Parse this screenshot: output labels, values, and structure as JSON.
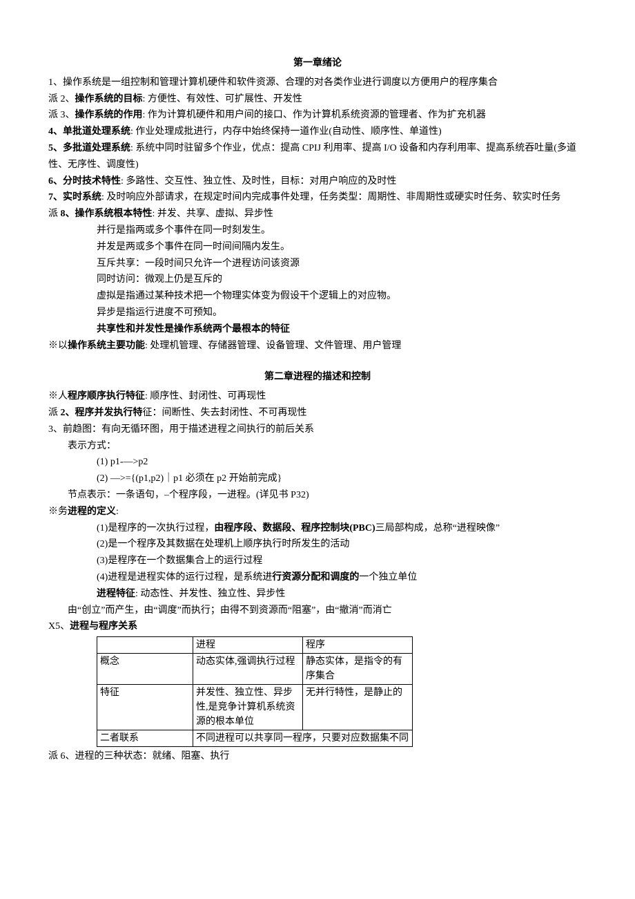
{
  "ch1": {
    "title": "第一章绪论",
    "p1": "1、操作系统是一组控制和管理计算机硬件和软件资源、合理的对各类作业进行调度以方便用户的程序集合",
    "p2_prefix": "派 2、",
    "p2_bold": "操作系统的目标",
    "p2_rest": ":  方便性、有效性、可扩展性、开发性",
    "p3_prefix": "派 3、",
    "p3_bold": "操作系统的作用",
    "p3_rest": ":  作为计算机硬件和用户间的接口、作为计算机系统资源的管理者、作为扩充机器",
    "p4_prefix": "4、",
    "p4_bold": "单批道处理系统",
    "p4_rest": ":  作业处理成批进行，内存中始终保持一道作业(自动性、顺序性、单道性)",
    "p5_prefix": "5、",
    "p5_bold": "多批道处理系统",
    "p5_rest": ":  系统中同时驻留多个作业，优点：提高 CPIJ 利用率、提高 I/O 设备和内存利用率、提高系统吞吐量(多道性、无序性、调度性)",
    "p6_prefix": "6、",
    "p6_bold": "分时技术特性",
    "p6_rest": ":  多路性、交互性、独立性、及时性，目标：对用户响应的及时性",
    "p7_prefix": "7、",
    "p7_bold": "实时系统",
    "p7_rest": ":  及时响应外部请求，在规定时间内完成事件处理，任务类型：周期性、非周期性或硬实时任务、软实时任务",
    "p8_prefix": "派 ",
    "p8_num": "8、",
    "p8_bold": "操作系统根本特性",
    "p8_rest": ":  并发、共享、虚拟、异步性",
    "p8_a": "并行是指两或多个事件在同一时刻发生。",
    "p8_b": "并发是两或多个事件在同一时间间隔内发生。",
    "p8_c": "互斥共享：一段时间只允许一个进程访问该资源",
    "p8_d": "同时访问：微观上仍是互斥的",
    "p8_e": "虚拟是指通过某种技术把一个物理实体变为假设干个逻辑上的对应物。",
    "p8_f": "异步是指运行进度不可预知。",
    "p8_g": "共享性和并发性是操作系统两个最根本的特征",
    "p9_prefix": "※以",
    "p9_bold": "操作系统主要功能",
    "p9_rest": ":  处理机管理、存储器管理、设备管理、文件管理、用户管理"
  },
  "ch2": {
    "title": "第二章进程的描述和控制",
    "p1_prefix": "※人",
    "p1_bold": "程序顺序执行特征",
    "p1_rest": ":  顺序性、封闭性、可再现性",
    "p2_prefix": "派 ",
    "p2_num": "2、",
    "p2_bold": "程序并发执行特",
    "p2_rest": "征：间断性、失去封闭性、不可再现性",
    "p3": "3、前趋图：有向无循环图，用于描述进程之间执行的前后关系",
    "p3_a": "表示方式：",
    "p3_b": "(1)  p1-—>p2",
    "p3_c": "(2)  —>={(p1,p2)｜p1 必须在 p2 开始前完成}",
    "p3_d": "节点表示：一条语句，–个程序段，一进程。(详见书 P32)",
    "p4_prefix": "※务",
    "p4_bold": "进程的定义",
    "p4_rest": ":",
    "p4_a_pre": "(1)是程序的一次执行过程，",
    "p4_a_bold": "由程序段、数据段、程序控制块(PBC)",
    "p4_a_rest": "三局部构成，总称“进程映像”",
    "p4_b": "(2)是一个程序及其数据在处理机上顺序执行时所发生的活动",
    "p4_c": "(3)是程序在一个数据集合上的运行过程",
    "p4_d_pre": "(4)进程是进程实体的运行过程，是系统进",
    "p4_d_bold": "行资源分配和调度的",
    "p4_d_rest": "一个独立单位",
    "p4_e_bold": "进程特征",
    "p4_e_rest": ":  动态性、并发性、独立性、异步性",
    "p4_f": "由“创立”而产生，由“调度”而执行；由得不到资源而“阻塞”，由“撤消”而消亡",
    "p5_prefix": " X5、",
    "p5_bold": "进程与程序关系",
    "table": {
      "h1": "",
      "h2": "进程",
      "h3": "程序",
      "r1c1": "概念",
      "r1c2": "动态实体,强调执行过程",
      "r1c3": "静态实体，是指令的有序集合",
      "r2c1": "特征",
      "r2c2": "并发性、独立性、异步性,是竞争计算机系统资源的根本单位",
      "r2c3": "无并行特性，是静止的",
      "r3c1": "二者联系",
      "r3c23": "不同进程可以共享同一程序，只要对应数据集不同"
    },
    "p6": "派 6、进程的三种状态：就绪、阻塞、执行"
  }
}
